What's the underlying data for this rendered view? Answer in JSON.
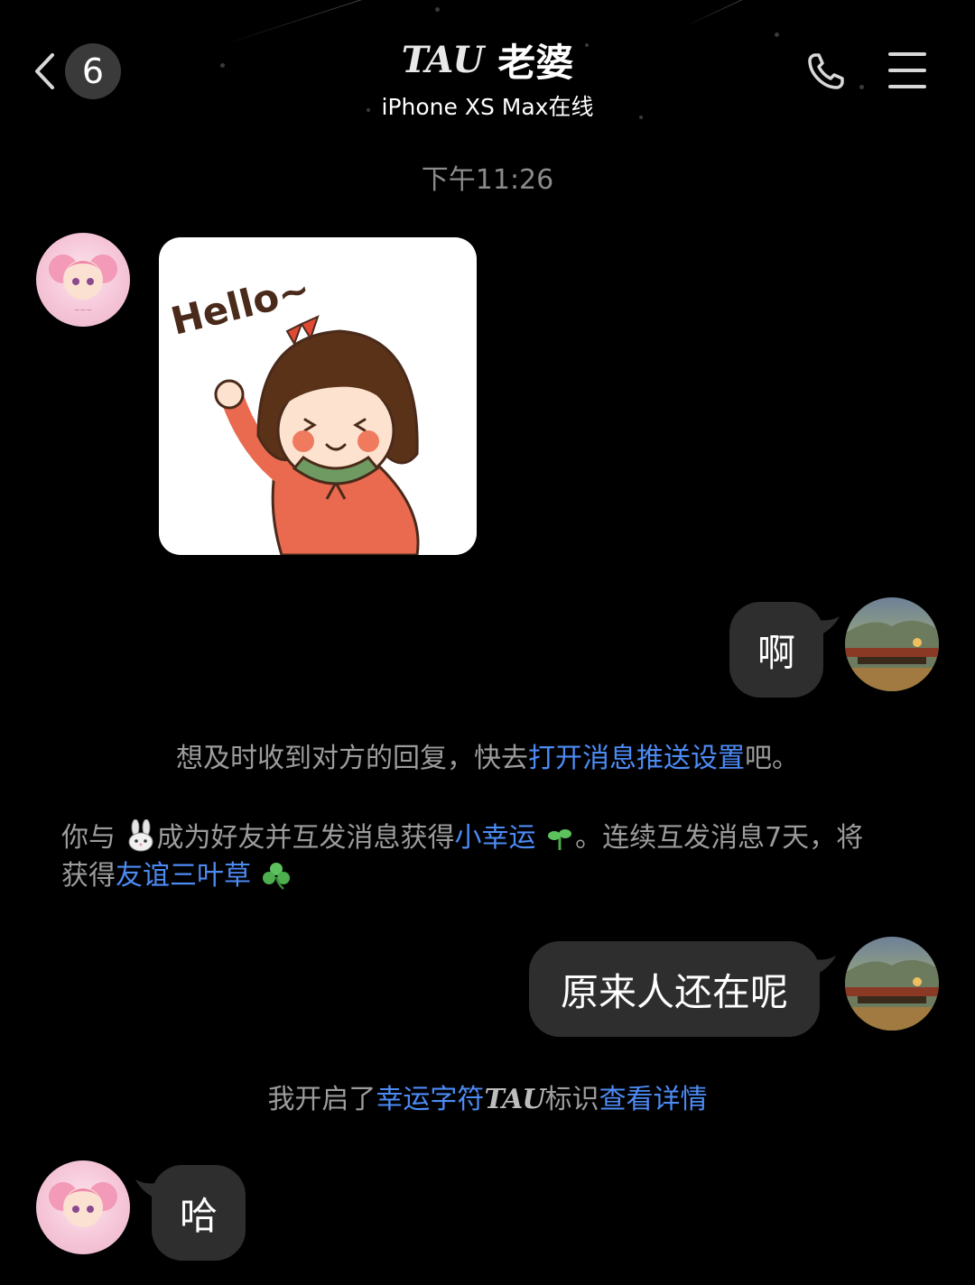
{
  "header": {
    "back_count": "6",
    "logo_text": "TAU",
    "contact_name": "老婆",
    "status": "iPhone XS Max在线"
  },
  "timestamp": "下午11:26",
  "sticker": {
    "text": "Hello~"
  },
  "messages": {
    "outgoing_1": "啊",
    "outgoing_2": "原来人还在呢",
    "incoming_last": "哈"
  },
  "notice_push": {
    "before": "想及时收到对方的回复，快去",
    "link": "打开消息推送设置",
    "after": "吧。"
  },
  "notice_friend": {
    "part1": "你与",
    "part2": "成为好友并互发消息获得",
    "link1": "小幸运",
    "part3": "。连续互发消息7天，将",
    "part4": "获得",
    "link2": "友谊三叶草"
  },
  "notice_tau": {
    "before": "我开启了",
    "link1": "幸运字符",
    "logo_text": "TAU",
    "middle": "标识",
    "link2": "查看详情"
  },
  "colors": {
    "link": "#4d8bf5",
    "bubble": "#2e2e2e",
    "system_text": "#9c9c9c"
  }
}
